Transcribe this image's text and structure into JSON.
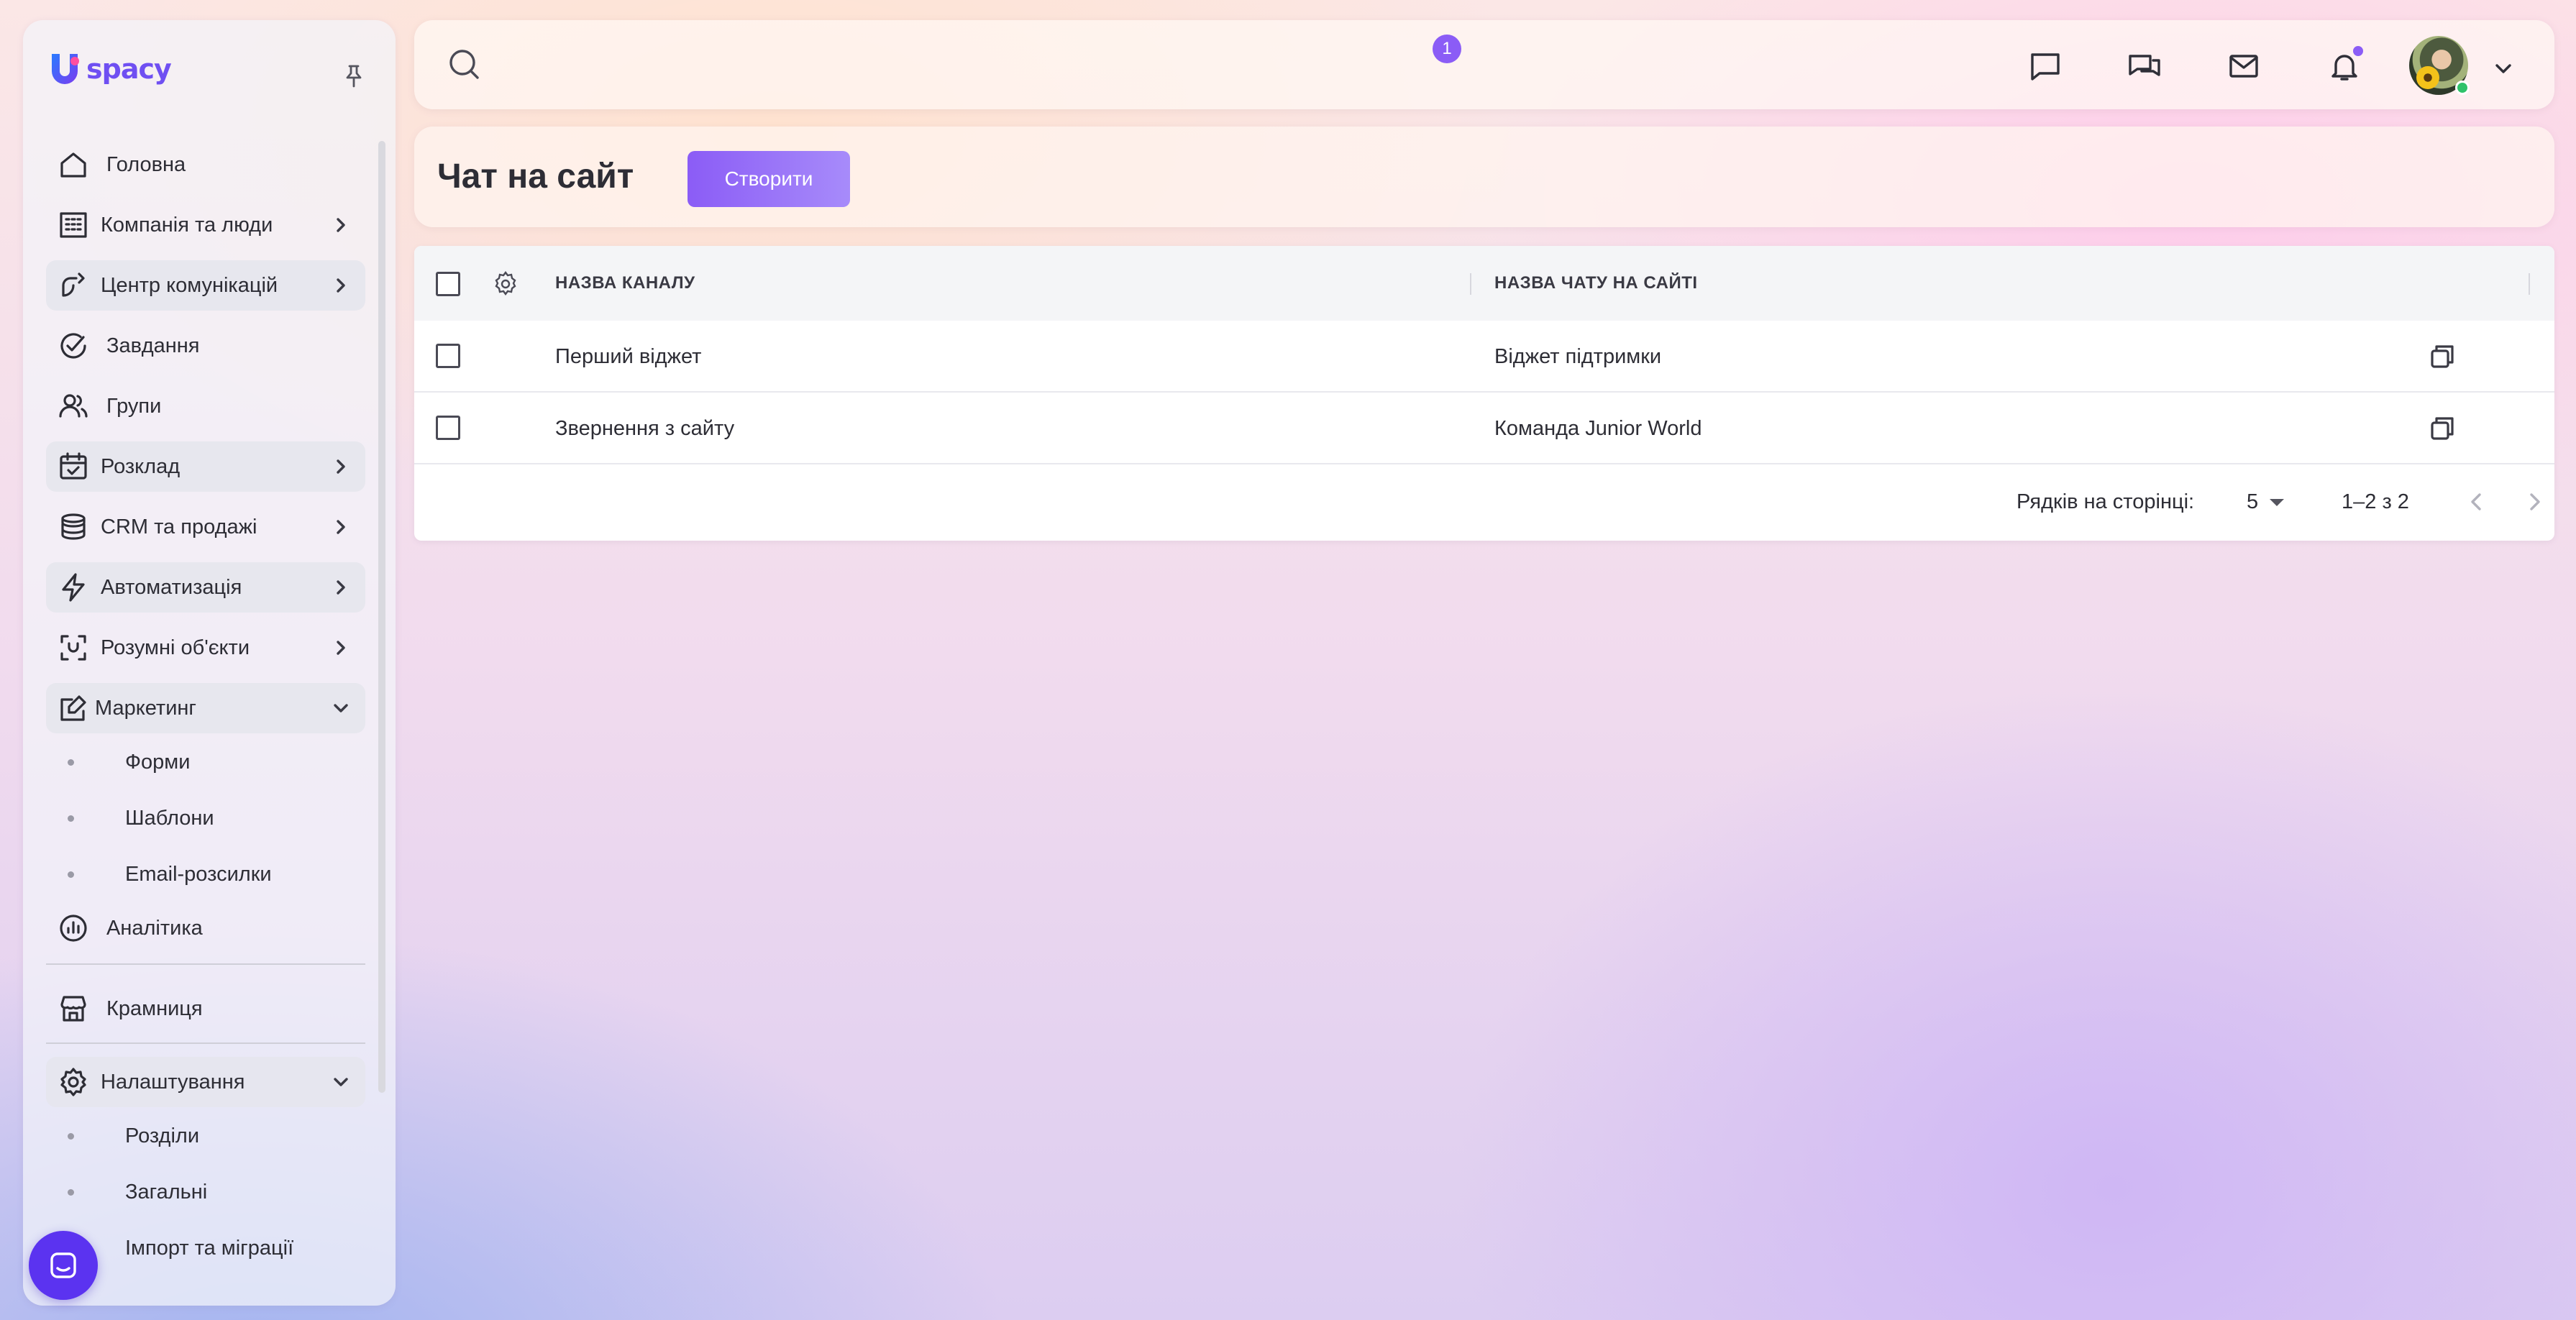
{
  "app": {
    "logo_text": "spacy",
    "brand_color": "#6f4ff2",
    "accent_color": "#8b5cf6"
  },
  "sidebar": {
    "items": [
      {
        "label": "Головна",
        "icon": "home-icon"
      },
      {
        "label": "Компанія та люди",
        "icon": "building-icon"
      },
      {
        "label": "Центр комунікацій",
        "icon": "communications-icon"
      },
      {
        "label": "Завдання",
        "icon": "check-circle-icon"
      },
      {
        "label": "Групи",
        "icon": "users-icon"
      },
      {
        "label": "Розклад",
        "icon": "calendar-icon"
      },
      {
        "label": "CRM та продажі",
        "icon": "coins-icon"
      },
      {
        "label": "Автоматизація",
        "icon": "bolt-icon"
      },
      {
        "label": "Розумні об'єкти",
        "icon": "smart-objects-icon"
      },
      {
        "label": "Маркетинг",
        "icon": "marketing-icon"
      },
      {
        "label": "Аналітика",
        "icon": "analytics-icon"
      },
      {
        "label": "Крамниця",
        "icon": "store-icon"
      },
      {
        "label": "Налаштування",
        "icon": "settings-icon"
      }
    ],
    "marketing_sub": [
      "Форми",
      "Шаблони",
      "Email-розсилки"
    ],
    "settings_sub": [
      "Розділи",
      "Загальні",
      "Імпорт та міграції"
    ]
  },
  "topbar": {
    "chat_badge": "1"
  },
  "page": {
    "title": "Чат на сайт",
    "create_label": "Створити"
  },
  "table": {
    "columns": [
      "НАЗВА КАНАЛУ",
      "НАЗВА ЧАТУ НА САЙТІ"
    ],
    "rows": [
      {
        "channel": "Перший віджет",
        "chat_name": "Віджет підтримки"
      },
      {
        "channel": "Звернення з сайту",
        "chat_name": "Команда Junior World"
      }
    ]
  },
  "pagination": {
    "rows_per_page_label": "Рядків на сторінці:",
    "rows_per_page": "5",
    "range": "1–2 з 2"
  }
}
